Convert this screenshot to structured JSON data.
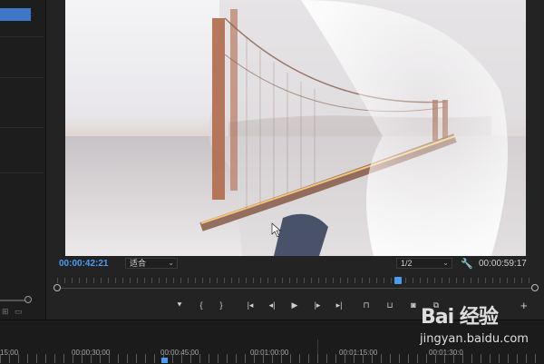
{
  "program_monitor": {
    "current_timecode": "00:00:42:21",
    "fit_label": "适合",
    "resolution_label": "1/2",
    "duration_timecode": "00:00:59:17",
    "transport_buttons": [
      {
        "icon": "marker-icon",
        "glyph": "⯆"
      },
      {
        "icon": "mark-in-icon",
        "glyph": "{"
      },
      {
        "icon": "mark-out-icon",
        "glyph": "}"
      },
      {
        "icon": "go-to-in-icon",
        "glyph": "|◂"
      },
      {
        "icon": "step-back-icon",
        "glyph": "◂|"
      },
      {
        "icon": "play-icon",
        "glyph": "▶"
      },
      {
        "icon": "step-forward-icon",
        "glyph": "|▸"
      },
      {
        "icon": "go-to-out-icon",
        "glyph": "▸|"
      },
      {
        "icon": "lift-icon",
        "glyph": "⊓"
      },
      {
        "icon": "extract-icon",
        "glyph": "⊔"
      },
      {
        "icon": "export-frame-icon",
        "glyph": "◙"
      },
      {
        "icon": "comparison-view-icon",
        "glyph": "⧉"
      }
    ],
    "add_glyph": "+"
  },
  "timeline": {
    "ruler_labels": [
      "15:00",
      "00:00:30:00",
      "00:00:45:00",
      "00:01:00:00",
      "00:01:15:00",
      "00:01:30:0"
    ]
  },
  "watermark": {
    "brand": "Bai 经验",
    "site": "jingyan.baidu.com"
  },
  "colors": {
    "accent": "#4a9cf2",
    "panel_bg": "#232323"
  }
}
